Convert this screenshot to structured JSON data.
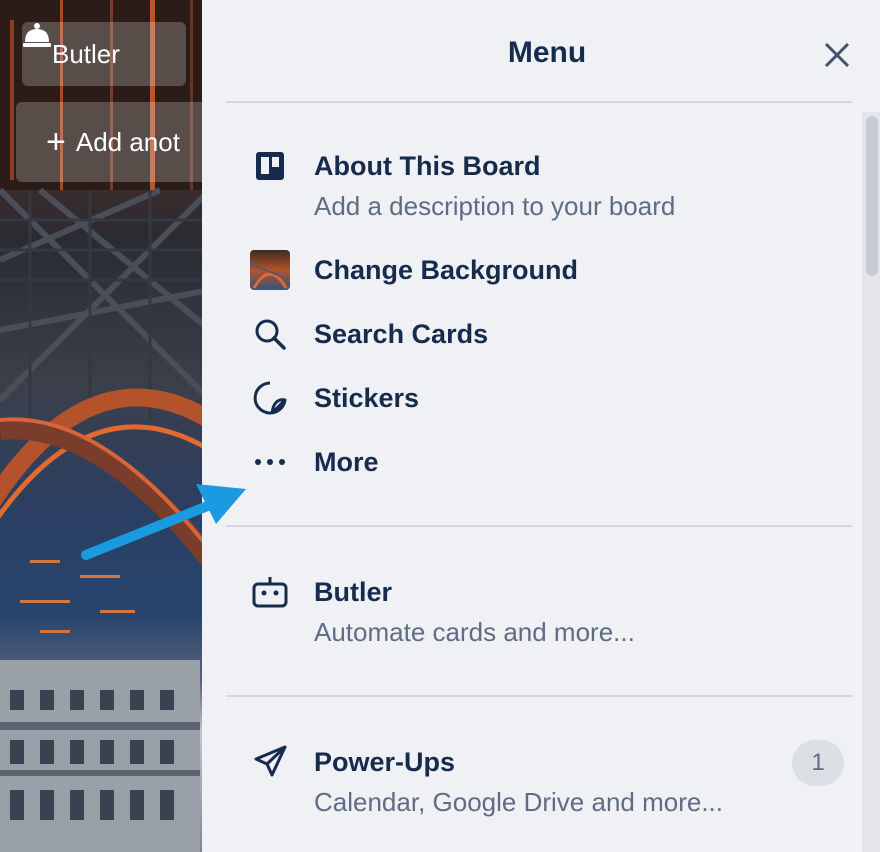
{
  "board": {
    "butler_label": "Butler",
    "add_list_label": "Add anot"
  },
  "menu": {
    "title": "Menu",
    "items": [
      {
        "icon": "board-icon",
        "label": "About This Board",
        "sub": "Add a description to your board"
      },
      {
        "icon": "background-thumbnail",
        "label": "Change Background"
      },
      {
        "icon": "search-icon",
        "label": "Search Cards"
      },
      {
        "icon": "sticker-icon",
        "label": "Stickers"
      },
      {
        "icon": "more-icon",
        "label": "More"
      }
    ],
    "butler": {
      "icon": "butler-robot-icon",
      "label": "Butler",
      "sub": "Automate cards and more..."
    },
    "powerups": {
      "icon": "rocket-icon",
      "label": "Power-Ups",
      "sub": "Calendar, Google Drive and more...",
      "count": "1"
    }
  },
  "colors": {
    "panel_bg": "#f0f1f5",
    "heading": "#172b4d",
    "subtext": "#5e6c84",
    "annotation_arrow": "#1a9ae0"
  }
}
